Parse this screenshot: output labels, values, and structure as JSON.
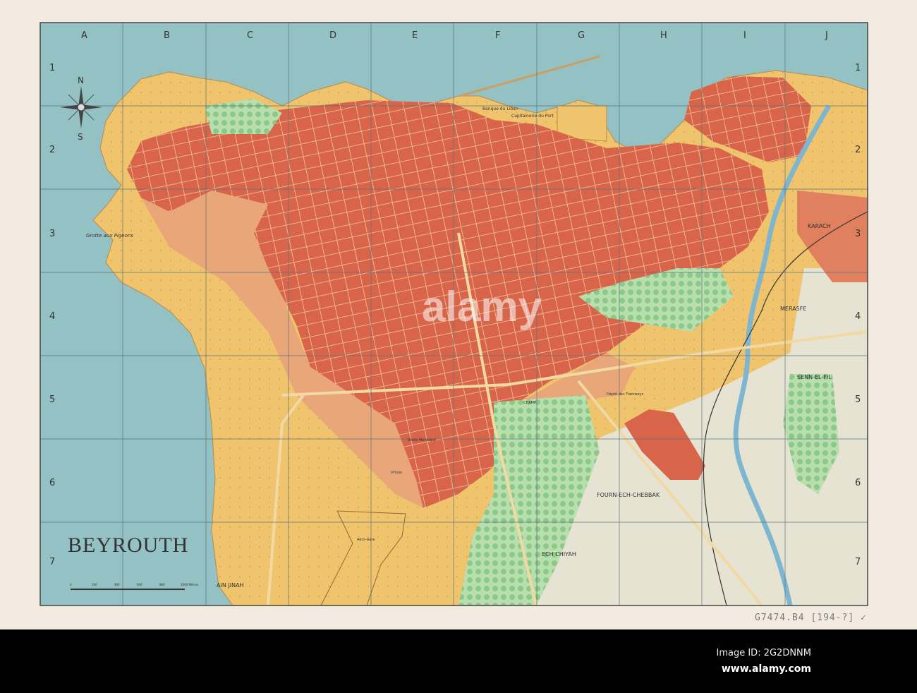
{
  "map": {
    "title": "BEYROUTH",
    "column_labels": [
      "A",
      "B",
      "C",
      "D",
      "E",
      "F",
      "G",
      "H",
      "I",
      "J"
    ],
    "row_labels": [
      "1",
      "2",
      "3",
      "4",
      "5",
      "6",
      "7"
    ],
    "compass": {
      "north": "N",
      "south": "S"
    },
    "scale": {
      "ticks": [
        "0",
        "200",
        "400",
        "600",
        "800",
        "1000 Mètres"
      ]
    },
    "places": [
      {
        "id": "grotte",
        "name": "Grotte aux Pigeons"
      },
      {
        "id": "banque",
        "name": "Banque du Liban"
      },
      {
        "id": "capitainerie",
        "name": "Capitainerie du Port"
      },
      {
        "id": "karach",
        "name": "KARACH"
      },
      {
        "id": "merasfe",
        "name": "MERASFE"
      },
      {
        "id": "senn",
        "name": "SENN-EL-FIL"
      },
      {
        "id": "fourn",
        "name": "FOURN-ECH-CHEBBAK"
      },
      {
        "id": "chiyah",
        "name": "ECH CHIYAH"
      },
      {
        "id": "ainjinah",
        "name": "AIN JINAH"
      },
      {
        "id": "stade",
        "name": "Stade Municipal"
      },
      {
        "id": "prison",
        "name": "Prison"
      },
      {
        "id": "aerogare",
        "name": "Aéro-Gare"
      },
      {
        "id": "champ",
        "name": "CHAMP"
      },
      {
        "id": "depot",
        "name": "Dépôt des Tramways"
      }
    ],
    "colors": {
      "sea": "#93c1c4",
      "sand": "#efc46c",
      "urban": "#d8654a",
      "suburb": "#e9a779",
      "green": "#a3d29c",
      "plain": "#e7e3d2",
      "river": "#7fb6cf",
      "paper": "#f3ebe0"
    }
  },
  "annotation": {
    "catalog": "G7474.B4 [194-?] ✓"
  },
  "watermark": {
    "logo": "alamy",
    "image_id": "Image ID: 2G2DNNM",
    "site": "www.alamy.com"
  }
}
